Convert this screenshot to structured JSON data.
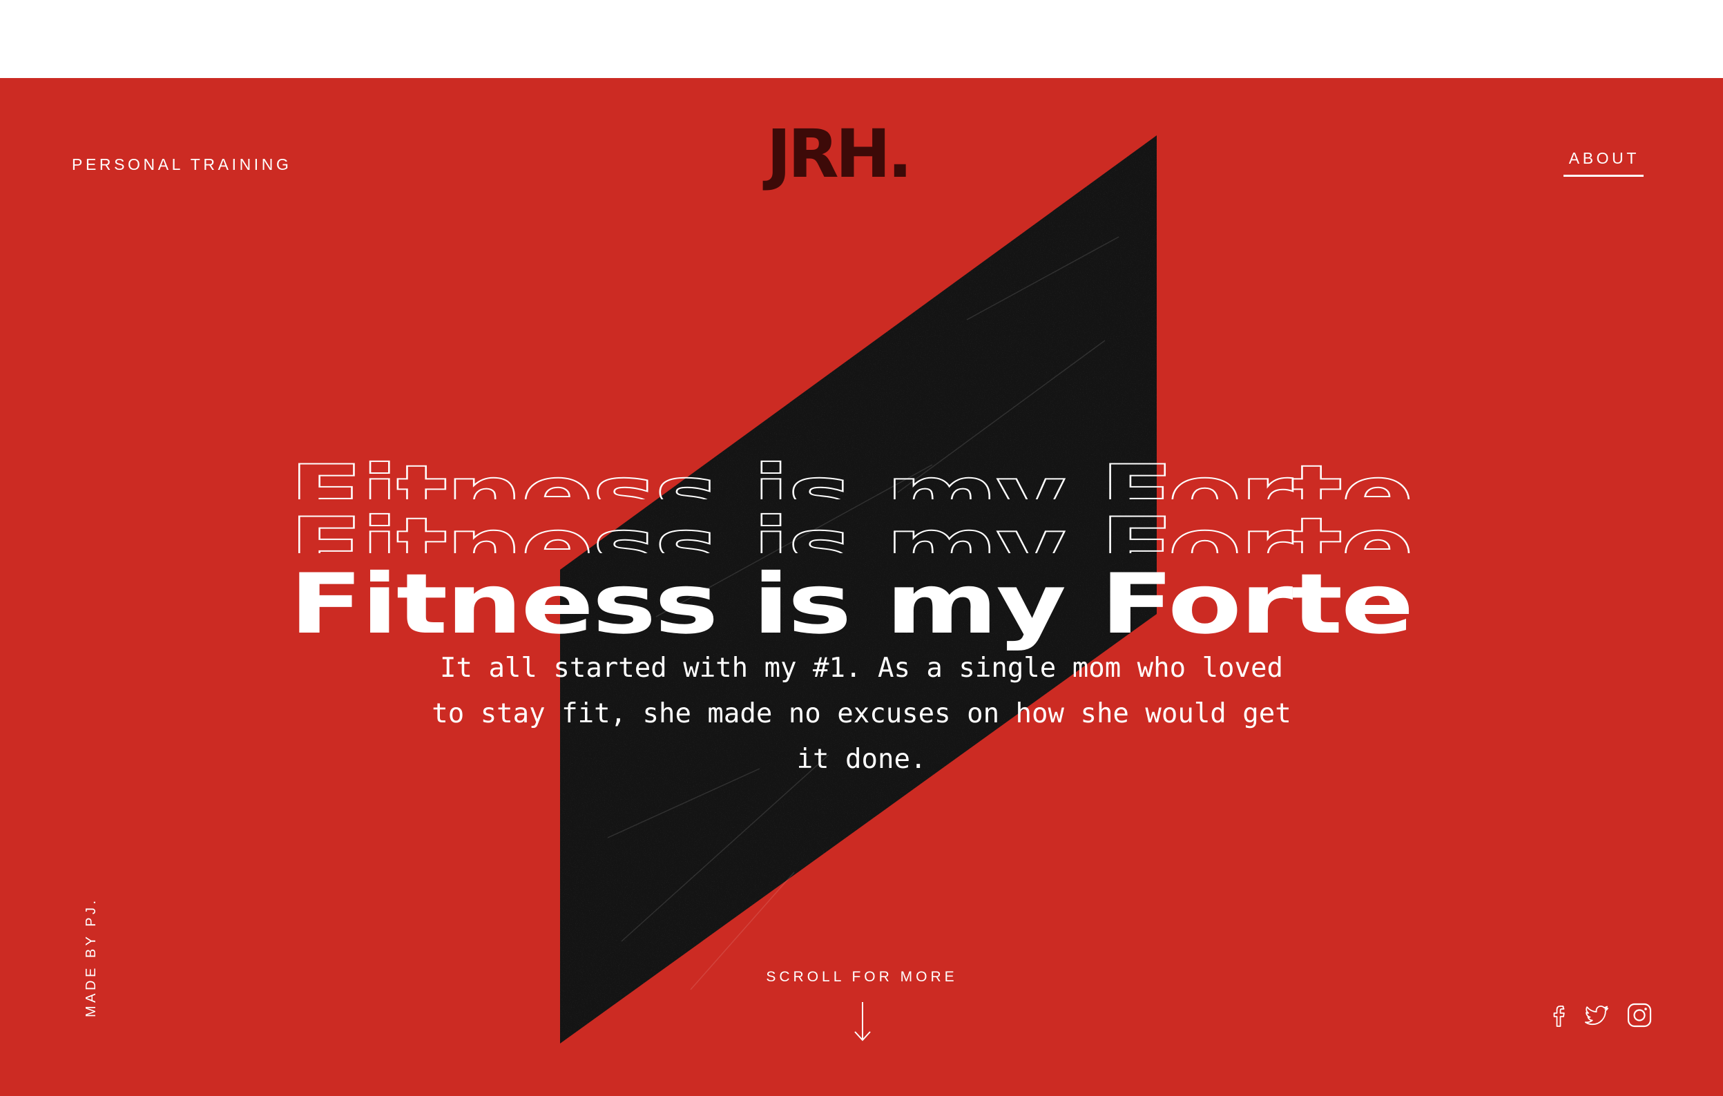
{
  "header": {
    "left_link": "PERSONAL TRAINING",
    "logo": "JRH.",
    "about_link": "ABOUT"
  },
  "hero": {
    "headline": "Fitness is my Forte",
    "intro": "It all started with my #1. As a single mom who loved to stay fit, she made no excuses on how she would get it done."
  },
  "footer": {
    "scroll_label": "SCROLL FOR MORE",
    "made_by": "MADE BY PJ.",
    "social": [
      "facebook-icon",
      "twitter-icon",
      "instagram-icon"
    ]
  },
  "colors": {
    "background": "#cc2b23",
    "logo": "#3d0a08",
    "text": "#ffffff",
    "panel": "#111111"
  }
}
